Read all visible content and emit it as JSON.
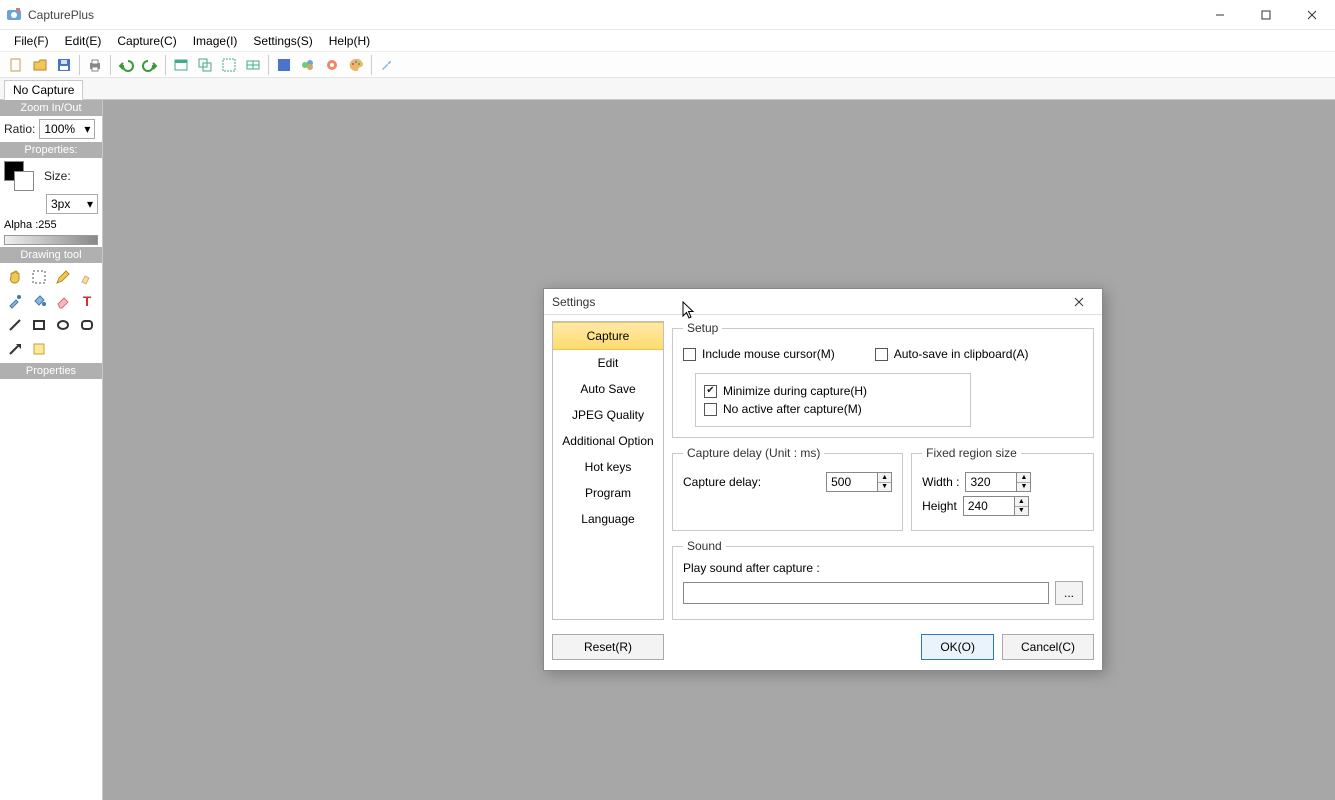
{
  "app": {
    "title": "CapturePlus"
  },
  "menu": {
    "file": "File(F)",
    "edit": "Edit(E)",
    "capture": "Capture(C)",
    "image": "Image(I)",
    "settings": "Settings(S)",
    "help": "Help(H)"
  },
  "tabs": {
    "no_capture": "No Capture"
  },
  "sidebar": {
    "zoom_head": "Zoom In/Out",
    "ratio_label": "Ratio:",
    "ratio_value": "100%",
    "props_head": "Properties:",
    "size_label": "Size:",
    "size_value": "3px",
    "alpha_label": "Alpha :255",
    "drawing_head": "Drawing tool",
    "props2_head": "Properties"
  },
  "dialog": {
    "title": "Settings",
    "nav": {
      "capture": "Capture",
      "edit": "Edit",
      "autosave": "Auto Save",
      "jpeg": "JPEG Quality",
      "additional": "Additional Option",
      "hotkeys": "Hot keys",
      "program": "Program",
      "language": "Language"
    },
    "setup": {
      "legend": "Setup",
      "include_cursor": "Include mouse cursor(M)",
      "autosave_clip": "Auto-save in clipboard(A)",
      "minimize": "Minimize during capture(H)",
      "no_active": "No active after capture(M)"
    },
    "delay": {
      "legend": "Capture delay (Unit : ms)",
      "label": "Capture delay:",
      "value": "500"
    },
    "region": {
      "legend": "Fixed region size",
      "width_label": "Width :",
      "width_value": "320",
      "height_label": "Height",
      "height_value": "240"
    },
    "sound": {
      "legend": "Sound",
      "label": "Play sound after capture :",
      "path": "",
      "browse": "..."
    },
    "buttons": {
      "reset": "Reset(R)",
      "ok": "OK(O)",
      "cancel": "Cancel(C)"
    }
  }
}
